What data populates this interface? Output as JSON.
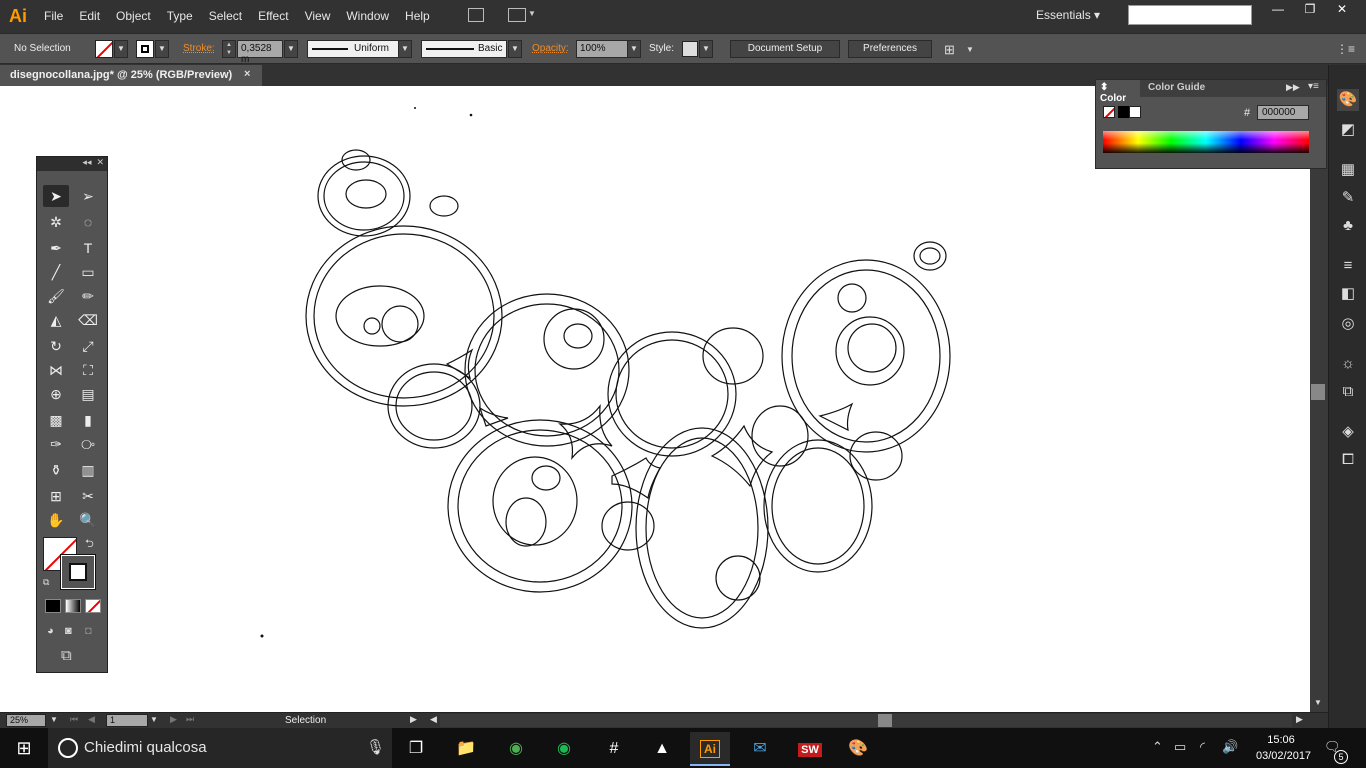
{
  "app": {
    "logo": "Ai",
    "menu": [
      "File",
      "Edit",
      "Object",
      "Type",
      "Select",
      "Effect",
      "View",
      "Window",
      "Help"
    ],
    "workspace": "Essentials"
  },
  "control": {
    "selection": "No Selection",
    "stroke_label": "Stroke:",
    "stroke_value": "0,3528 m",
    "profile": "Uniform",
    "brush": "Basic",
    "opacity_label": "Opacity:",
    "opacity_value": "100%",
    "style_label": "Style:",
    "document_setup": "Document Setup",
    "preferences": "Preferences"
  },
  "document": {
    "tab_title": "disegnocollana.jpg* @ 25% (RGB/Preview)",
    "close": "×"
  },
  "color_panel": {
    "tab_color": "Color",
    "tab_guide": "Color Guide",
    "hash": "#",
    "hex_value": "000000"
  },
  "status": {
    "zoom": "25%",
    "artboard": "1",
    "tool": "Selection"
  },
  "taskbar": {
    "search_placeholder": "Chiedimi qualcosa",
    "time": "15:06",
    "date": "03/02/2017",
    "notifications": "5"
  },
  "icons": {
    "ai_app_label": "Ai",
    "sw_app_label": "SW"
  }
}
